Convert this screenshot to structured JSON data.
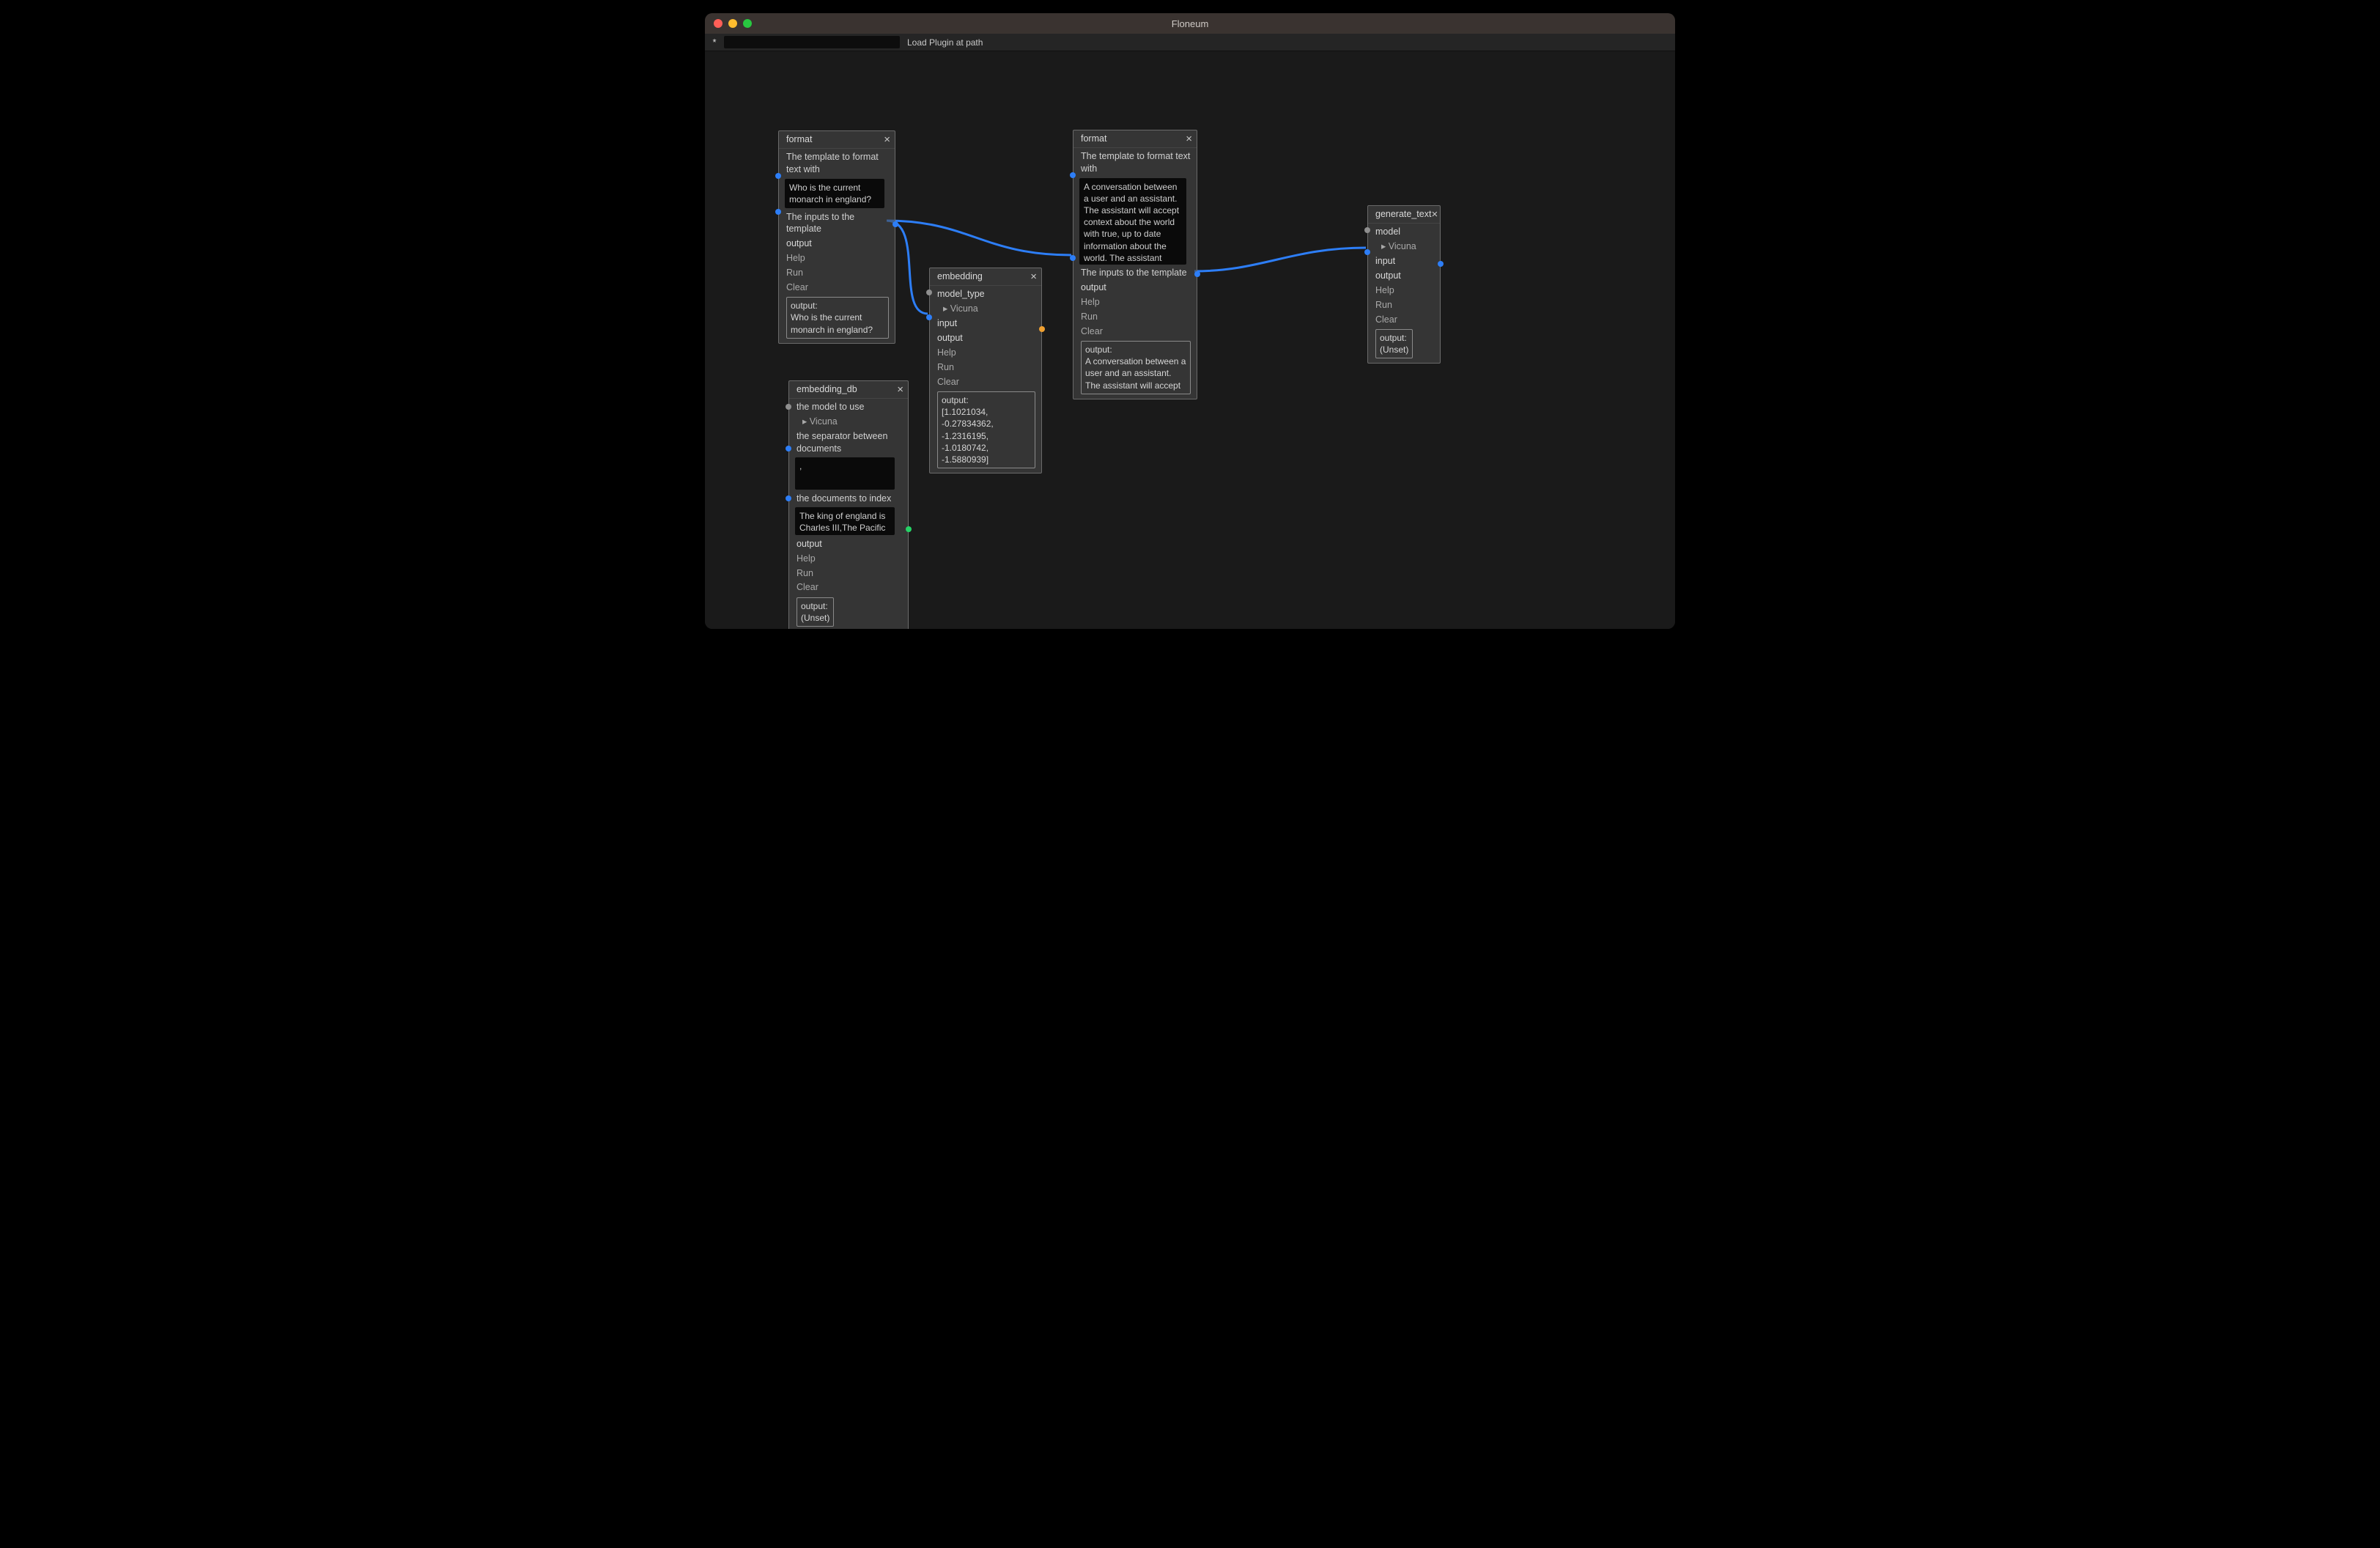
{
  "window": {
    "title": "Floneum"
  },
  "toolbar": {
    "indicator": "*",
    "load_label": "Load Plugin at path"
  },
  "nodes": {
    "format1": {
      "title": "format",
      "desc": "The template to format text with",
      "template_text": "Who is the current monarch in england?",
      "inputs_label": "The inputs to the template",
      "output_label": "output",
      "help": "Help",
      "run": "Run",
      "clear": "Clear",
      "output_box": "output:\nWho is the current monarch in england?"
    },
    "embedding": {
      "title": "embedding",
      "model_type_label": "model_type",
      "model_type_value": "▸ Vicuna",
      "input_label": "input",
      "output_label": "output",
      "help": "Help",
      "run": "Run",
      "clear": "Clear",
      "output_box": "output:\n[1.1021034, -0.27834362, -1.2316195, -1.0180742, -1.5880939]"
    },
    "embedding_db": {
      "title": "embedding_db",
      "model_label": "the model to use",
      "model_value": "▸ Vicuna",
      "separator_label": "the separator between documents",
      "separator_text": ",",
      "docs_label": "the documents to index",
      "docs_text": "The king of england is Charles III,The Pacific Ocean is the largest ocean which covers",
      "output_label": "output",
      "help": "Help",
      "run": "Run",
      "clear": "Clear",
      "output_box": "output:\n(Unset)"
    },
    "format2": {
      "title": "format",
      "desc": "The template to format text with",
      "template_text": "A conversation between a user and an assistant. The assistant will accept context about the world with true, up to date information about the world. The assistant uses the infomation in the context to answer susinctly:",
      "inputs_label": "The inputs to the template",
      "output_label": "output",
      "help": "Help",
      "run": "Run",
      "clear": "Clear",
      "output_box": "output:\nA conversation between a user and an assistant. The assistant will accept"
    },
    "generate_text": {
      "title": "generate_text",
      "model_label": "model",
      "model_value": "▸ Vicuna",
      "input_label": "input",
      "output_label": "output",
      "help": "Help",
      "run": "Run",
      "clear": "Clear",
      "output_box": "output:\n(Unset)"
    }
  },
  "edges": [
    {
      "from": "format1.output",
      "to": "embedding.input"
    },
    {
      "from": "format1.output",
      "to": "format2.inputs"
    },
    {
      "from": "format2.output",
      "to": "generate_text.input"
    }
  ],
  "colors": {
    "edge": "#2d7ef7",
    "port_blue": "#2d7ef7",
    "port_orange": "#f0a030",
    "port_green": "#25d366"
  }
}
